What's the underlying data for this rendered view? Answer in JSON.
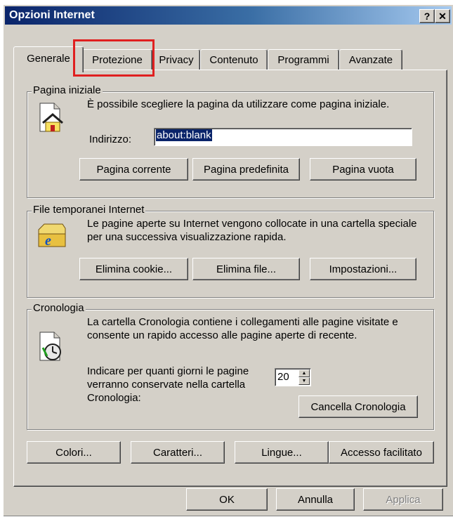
{
  "window": {
    "title": "Opzioni Internet"
  },
  "titlebar_buttons": {
    "help": "?",
    "close": "✕"
  },
  "tabs": [
    {
      "label": "Generale"
    },
    {
      "label": "Protezione"
    },
    {
      "label": "Privacy"
    },
    {
      "label": "Contenuto"
    },
    {
      "label": "Programmi"
    },
    {
      "label": "Avanzate"
    }
  ],
  "home_page": {
    "legend": "Pagina iniziale",
    "description": "È possibile scegliere la pagina da utilizzare come pagina iniziale.",
    "address_label": "Indirizzo:",
    "address_value": "about:blank",
    "buttons": {
      "current": "Pagina corrente",
      "default": "Pagina predefinita",
      "blank": "Pagina vuota"
    },
    "icon": "home-page-icon"
  },
  "temp_files": {
    "legend": "File temporanei Internet",
    "description": "Le pagine aperte su Internet vengono collocate in una cartella speciale per una successiva visualizzazione rapida.",
    "buttons": {
      "delete_cookies": "Elimina cookie...",
      "delete_files": "Elimina file...",
      "settings": "Impostazioni..."
    },
    "icon": "ie-folder-icon"
  },
  "history": {
    "legend": "Cronologia",
    "description": "La cartella Cronologia contiene i collegamenti alle pagine visitate e consente un rapido accesso alle pagine aperte di recente.",
    "days_label": "Indicare per quanti giorni le pagine verranno conservate nella cartella Cronologia:",
    "days_value": "20",
    "clear_button": "Cancella Cronologia",
    "icon": "history-clock-icon"
  },
  "bottom_buttons": {
    "colors": "Colori...",
    "fonts": "Caratteri...",
    "languages": "Lingue...",
    "accessibility": "Accesso facilitato"
  },
  "dialog_buttons": {
    "ok": "OK",
    "cancel": "Annulla",
    "apply": "Applica"
  },
  "colors": {
    "titlebar_start": "#0a246a",
    "face": "#d4d0c8",
    "highlight_box": "#e02020",
    "selection": "#0a246a"
  }
}
